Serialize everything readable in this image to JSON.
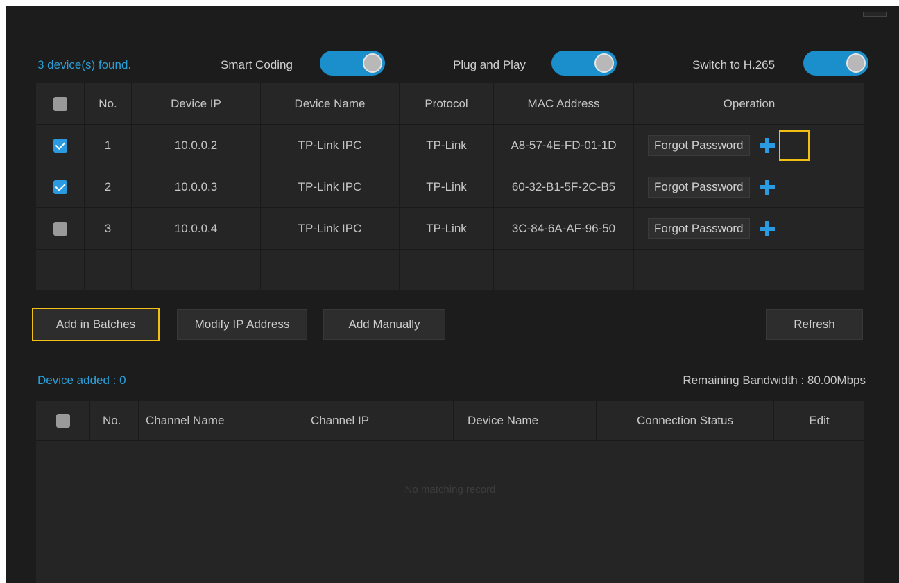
{
  "discovery": {
    "found_text": "3 device(s) found.",
    "toggles": [
      {
        "label": "Smart Coding",
        "on": true
      },
      {
        "label": "Plug and Play",
        "on": true
      },
      {
        "label": "Switch to H.265",
        "on": true
      }
    ],
    "columns": [
      "No.",
      "Device IP",
      "Device Name",
      "Protocol",
      "MAC Address",
      "Operation"
    ],
    "rows": [
      {
        "checked": true,
        "no": "1",
        "ip": "10.0.0.2",
        "name": "TP-Link IPC",
        "protocol": "TP-Link",
        "mac": "A8-57-4E-FD-01-1D",
        "op": "Forgot Password"
      },
      {
        "checked": true,
        "no": "2",
        "ip": "10.0.0.3",
        "name": "TP-Link IPC",
        "protocol": "TP-Link",
        "mac": "60-32-B1-5F-2C-B5",
        "op": "Forgot Password"
      },
      {
        "checked": false,
        "no": "3",
        "ip": "10.0.0.4",
        "name": "TP-Link IPC",
        "protocol": "TP-Link",
        "mac": "3C-84-6A-AF-96-50",
        "op": "Forgot Password"
      }
    ]
  },
  "actions": {
    "add_batches": "Add in Batches",
    "modify_ip": "Modify IP Address",
    "add_manually": "Add Manually",
    "refresh": "Refresh"
  },
  "added": {
    "label": "Device added : 0",
    "bandwidth": "Remaining Bandwidth : 80.00Mbps",
    "columns": [
      "No.",
      "Channel Name",
      "Channel IP",
      "Device Name",
      "Connection Status",
      "Edit"
    ],
    "empty_text": "No matching record"
  },
  "colors": {
    "accent": "#2a9be0",
    "highlight": "#f2c014",
    "background": "#1c1c1c"
  }
}
